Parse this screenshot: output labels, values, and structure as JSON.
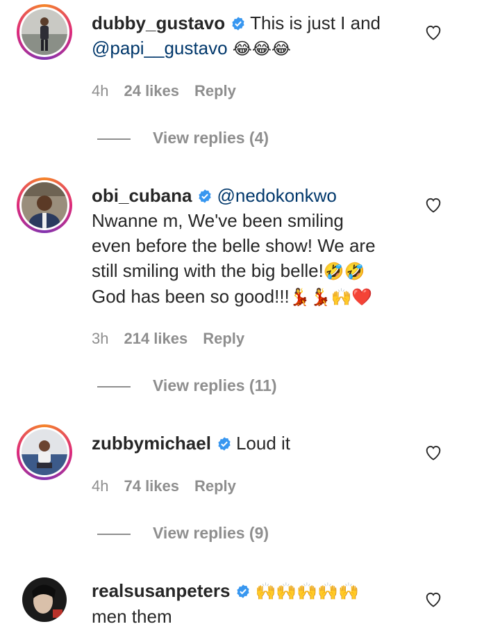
{
  "comments": [
    {
      "username": "dubby_gustavo",
      "verified": true,
      "text_line1": "This is just I and",
      "mention": "@papi__gustavo",
      "emoji": "😂😂😂",
      "time": "4h",
      "likes": "24 likes",
      "reply": "Reply",
      "view_replies": "View replies (4)"
    },
    {
      "username": "obi_cubana",
      "verified": true,
      "mention": "@nedokonkwo",
      "line1": "Nwanne m, We've been smiling",
      "line2": "even before the belle show! We are",
      "line3": "still smiling with the big belle!",
      "line3_emoji": "🤣🤣",
      "line4": "God has been so good!!!",
      "line4_emoji": "💃💃🙌❤️",
      "time": "3h",
      "likes": "214 likes",
      "reply": "Reply",
      "view_replies": "View replies (11)"
    },
    {
      "username": "zubbymichael",
      "verified": true,
      "text": "Loud it",
      "time": "4h",
      "likes": "74 likes",
      "reply": "Reply",
      "view_replies": "View replies (9)"
    },
    {
      "username": "realsusanpeters",
      "verified": true,
      "emoji": "🙌🙌🙌🙌🙌",
      "line2": "men them"
    }
  ],
  "colors": {
    "verified_badge": "#3897f0",
    "mention": "#00376b",
    "meta": "#8e8e8e"
  }
}
